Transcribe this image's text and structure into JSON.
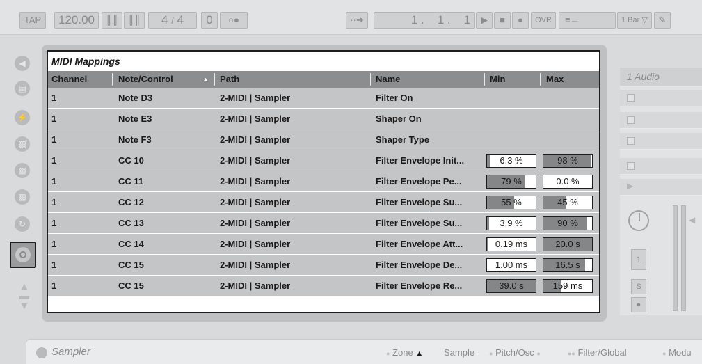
{
  "transport": {
    "tap_label": "TAP",
    "tempo": "120.00",
    "time_sig_num": "4",
    "time_sig_sep": "/",
    "time_sig_den": "4",
    "metronome_value": "0",
    "position_bar": "1",
    "position_beat": "1",
    "position_sixteenth": "1",
    "ovr_label": "OVR",
    "quantize_label": "1 Bar"
  },
  "midi_mappings": {
    "title": "MIDI Mappings",
    "columns": [
      "Channel",
      "Note/Control",
      "Path",
      "Name",
      "Min",
      "Max"
    ],
    "rows": [
      {
        "channel": "1",
        "control": "Note D3",
        "path": "2-MIDI | Sampler",
        "name": "Filter On",
        "min": "",
        "max": "",
        "min_fill": 0,
        "max_fill": 0
      },
      {
        "channel": "1",
        "control": "Note E3",
        "path": "2-MIDI | Sampler",
        "name": "Shaper On",
        "min": "",
        "max": "",
        "min_fill": 0,
        "max_fill": 0
      },
      {
        "channel": "1",
        "control": "Note F3",
        "path": "2-MIDI | Sampler",
        "name": "Shaper Type",
        "min": "",
        "max": "",
        "min_fill": 0,
        "max_fill": 0
      },
      {
        "channel": "1",
        "control": "CC 10",
        "path": "2-MIDI | Sampler",
        "name": "Filter Envelope Init...",
        "min": "6.3 %",
        "max": "98 %",
        "min_fill": 0.063,
        "max_fill": 0.98
      },
      {
        "channel": "1",
        "control": "CC 11",
        "path": "2-MIDI | Sampler",
        "name": "Filter Envelope Pe...",
        "min": "79 %",
        "max": "0.0 %",
        "min_fill": 0.79,
        "max_fill": 0.0
      },
      {
        "channel": "1",
        "control": "CC 12",
        "path": "2-MIDI | Sampler",
        "name": "Filter Envelope Su...",
        "min": "55 %",
        "max": "45 %",
        "min_fill": 0.55,
        "max_fill": 0.45
      },
      {
        "channel": "1",
        "control": "CC 13",
        "path": "2-MIDI | Sampler",
        "name": "Filter Envelope Su...",
        "min": "3.9 %",
        "max": "90 %",
        "min_fill": 0.039,
        "max_fill": 0.9
      },
      {
        "channel": "1",
        "control": "CC 14",
        "path": "2-MIDI | Sampler",
        "name": "Filter Envelope Att...",
        "min": "0.19 ms",
        "max": "20.0 s",
        "min_fill": 0.02,
        "max_fill": 1.0
      },
      {
        "channel": "1",
        "control": "CC 15",
        "path": "2-MIDI | Sampler",
        "name": "Filter Envelope De...",
        "min": "1.00 ms",
        "max": "16.5 s",
        "min_fill": 0.0,
        "max_fill": 0.86
      },
      {
        "channel": "1",
        "control": "CC 15",
        "path": "2-MIDI | Sampler",
        "name": "Filter Envelope Re...",
        "min": "39.0 s",
        "max": "159 ms",
        "min_fill": 1.0,
        "max_fill": 0.35
      }
    ]
  },
  "track": {
    "title": "1 Audio",
    "track_number": "1",
    "solo_label": "S"
  },
  "device": {
    "name": "Sampler",
    "tabs": [
      "Zone",
      "Sample",
      "Pitch/Osc",
      "Filter/Global",
      "Modu"
    ]
  },
  "colors": {
    "row_bg": "#c4c5c6",
    "header_bg": "#8c8d8e",
    "value_fill": "#858687"
  },
  "icons": {
    "sidebar": [
      "browser-back-icon",
      "device-browser-icon",
      "plugin-browser-icon",
      "clips-folder-icon",
      "samples-folder-icon",
      "library-folder-icon",
      "refresh-icon",
      "midi-map-icon"
    ]
  }
}
